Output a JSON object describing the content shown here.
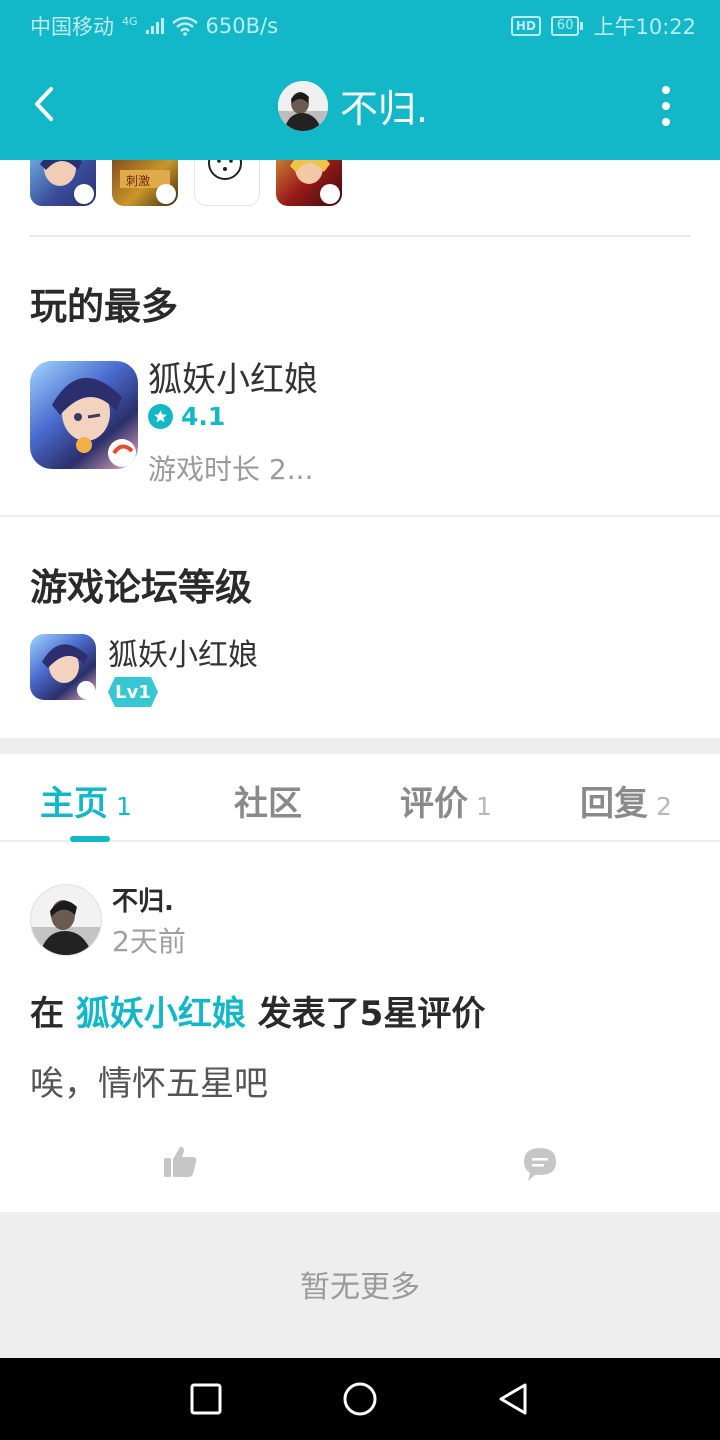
{
  "status_bar": {
    "carrier": "中国移动",
    "network": "4G",
    "speed": "650B/s",
    "hd": "HD",
    "battery": "60",
    "time": "上午10:22"
  },
  "header": {
    "title": "不归.",
    "back_icon": "back-arrow-icon",
    "more_icon": "more-vertical-icon",
    "bg_color": "#12b8c8"
  },
  "games_strip": {
    "items": [
      "game-icon-1",
      "game-icon-2",
      "game-icon-3",
      "game-icon-4"
    ]
  },
  "most_played": {
    "title": "玩的最多",
    "game": {
      "name": "狐妖小红娘",
      "rating": "4.1",
      "playtime": "游戏时长 2..."
    }
  },
  "forum_level": {
    "title": "游戏论坛等级",
    "game": {
      "name": "狐妖小红娘",
      "level": "Lv1"
    }
  },
  "tabs": [
    {
      "label": "主页",
      "count": "1",
      "active": true
    },
    {
      "label": "社区",
      "count": "",
      "active": false
    },
    {
      "label": "评价",
      "count": "1",
      "active": false
    },
    {
      "label": "回复",
      "count": "2",
      "active": false
    }
  ],
  "post": {
    "user": "不归.",
    "time": "2天前",
    "headline_prefix": "在",
    "headline_game": "狐妖小红娘",
    "headline_suffix": "发表了5星评价",
    "body": "唉，情怀五星吧",
    "like_icon": "thumbs-up-icon",
    "comment_icon": "comment-icon"
  },
  "footer": {
    "no_more": "暂无更多"
  },
  "nav_bar": {
    "items": [
      "recent-apps-icon",
      "home-icon",
      "back-triangle-icon"
    ]
  },
  "colors": {
    "accent": "#12b8c8",
    "gray_bg": "#eeeeee"
  }
}
